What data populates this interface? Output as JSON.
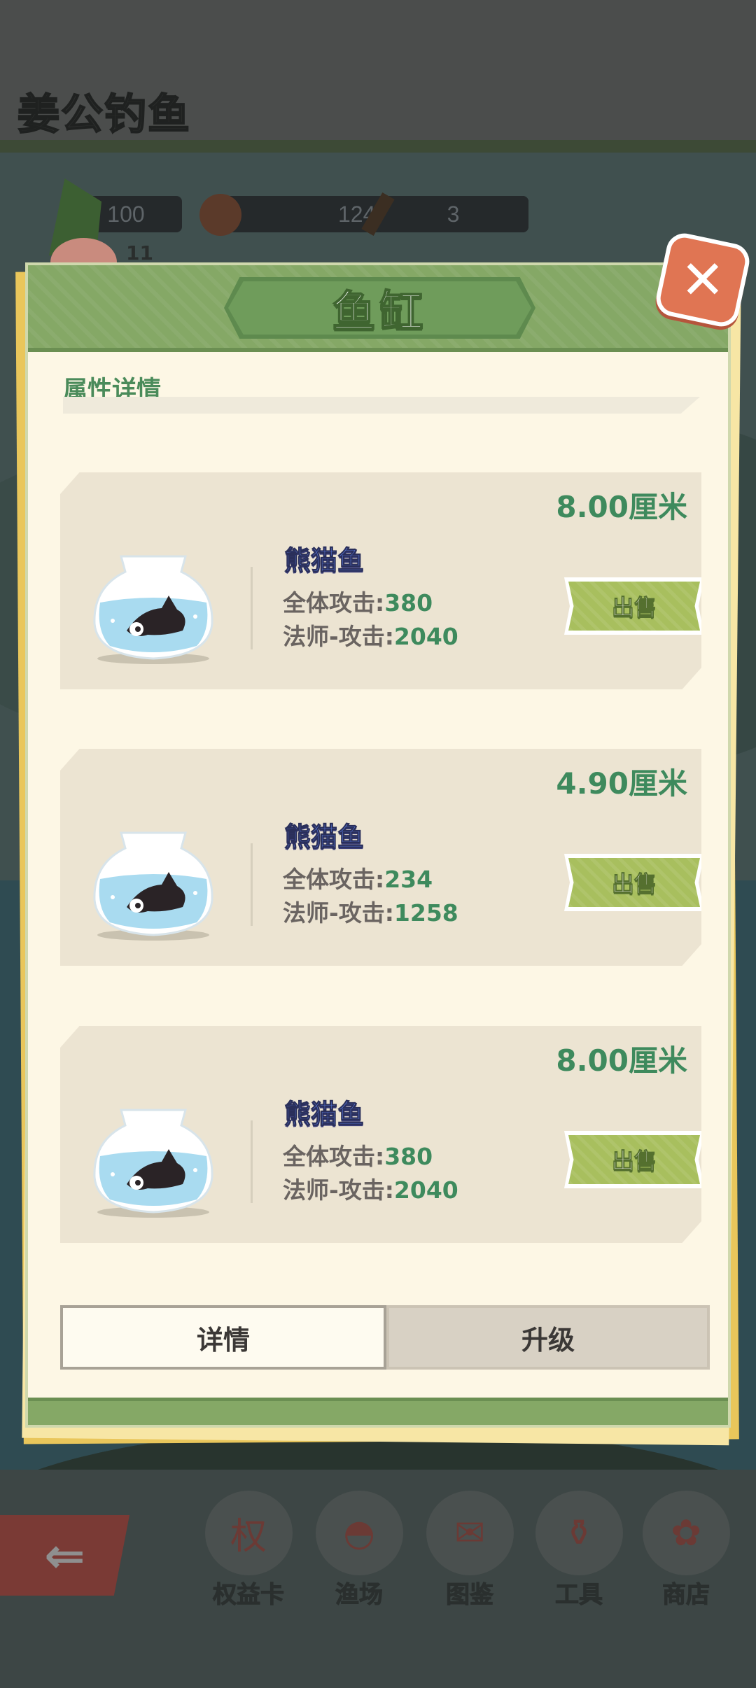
{
  "background": {
    "game_title": "姜公钓鱼",
    "resources": [
      {
        "icon": "coin-icon",
        "value": "100"
      },
      {
        "icon": "boar-icon",
        "value": "12448"
      },
      {
        "icon": "hammer-icon",
        "value": "3"
      }
    ],
    "level_text": "11",
    "bottom_nav": [
      {
        "label": "权益卡",
        "icon": "card-icon",
        "glyph": "权"
      },
      {
        "label": "渔场",
        "icon": "fishing-ground-icon",
        "glyph": "◓"
      },
      {
        "label": "图鉴",
        "icon": "fish-scroll-icon",
        "glyph": "✉"
      },
      {
        "label": "工具",
        "icon": "tool-jar-icon",
        "glyph": "⚱"
      },
      {
        "label": "商店",
        "icon": "shop-bag-icon",
        "glyph": "✿"
      }
    ],
    "back_glyph": "⇐"
  },
  "modal": {
    "title": "鱼缸",
    "close_glyph": "✕",
    "section_title": "属性详情",
    "fish": [
      {
        "size": "8.00厘米",
        "name": "熊猫鱼",
        "stat1_label": "全体攻击:",
        "stat1_value": "380",
        "stat2_label": "法师-攻击:",
        "stat2_value": "2040",
        "sell_label": "出售"
      },
      {
        "size": "4.90厘米",
        "name": "熊猫鱼",
        "stat1_label": "全体攻击:",
        "stat1_value": "234",
        "stat2_label": "法师-攻击:",
        "stat2_value": "1258",
        "sell_label": "出售"
      },
      {
        "size": "8.00厘米",
        "name": "熊猫鱼",
        "stat1_label": "全体攻击:",
        "stat1_value": "380",
        "stat2_label": "法师-攻击:",
        "stat2_value": "2040",
        "sell_label": "出售"
      }
    ],
    "tabs": [
      {
        "label": "详情",
        "active": true
      },
      {
        "label": "升级",
        "active": false
      }
    ]
  },
  "colors": {
    "accent_green": "#3e8a5d",
    "header_green": "#85a866",
    "close_orange": "#e07553",
    "fish_name_blue": "#5a7be0"
  }
}
